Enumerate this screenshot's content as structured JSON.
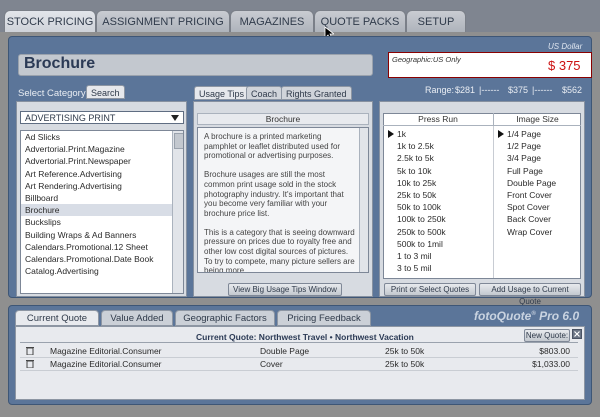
{
  "top_tabs": [
    "STOCK PRICING",
    "ASSIGNMENT PRICING",
    "MAGAZINES",
    "QUOTE PACKS",
    "SETUP"
  ],
  "header": {
    "title": "Brochure",
    "currency": "US Dollar",
    "geo_label": "Geographic:US Only",
    "price": "$ 375"
  },
  "range": {
    "label": "Range:",
    "low": "$281",
    "mid": "$375",
    "high": "$562",
    "sep": "|------"
  },
  "category": {
    "label": "Select Category",
    "search_tab": "Search",
    "dropdown_value": "ADVERTISING PRINT",
    "items": [
      "Ad Slicks",
      "Advertorial.Print.Magazine",
      "Advertorial.Print.Newspaper",
      "Art Reference.Advertising",
      "Art Rendering.Advertising",
      "Billboard",
      "Brochure",
      "Buckslips",
      "Building Wraps & Ad Banners",
      "Calendars.Promotional.12 Sheet",
      "Calendars.Promotional.Date Book",
      "Catalog.Advertising"
    ],
    "selected": "Brochure"
  },
  "middle": {
    "tabs": [
      "Usage Tips",
      "Coach",
      "Rights Granted"
    ],
    "heading": "Brochure",
    "paragraphs": [
      "A brochure is a printed marketing pamphlet or leaflet distributed used for promotional or advertising purposes.",
      "Brochure usages are still the most common print usage sold in the stock photography industry. It's important that you become very familiar with your brochure price list.",
      "This is a category that is seeing downward pressure on prices due to royalty free and other low cost digital sources of pictures. To try to compete, many picture sellers are being more"
    ],
    "button": "View Big Usage Tips Window"
  },
  "press_run": {
    "header": "Press Run",
    "items": [
      "1k",
      "1k to 2.5k",
      "2.5k to 5k",
      "5k to 10k",
      "10k to 25k",
      "25k to 50k",
      "50k to 100k",
      "100k to 250k",
      "250k to 500k",
      "500k to 1mil",
      "1 to 3 mil",
      "3 to 5 mil"
    ],
    "selected": "1k"
  },
  "image_size": {
    "header": "Image Size",
    "items": [
      "1/4 Page",
      "1/2 Page",
      "3/4 Page",
      "Full Page",
      "Double Page",
      "Front Cover",
      "Spot Cover",
      "Back Cover",
      "Wrap Cover"
    ],
    "selected": "1/4 Page"
  },
  "buttons": {
    "print": "Print or Select Quotes",
    "add": "Add Usage to Current Quote",
    "new_quote": "New Quote:"
  },
  "bottom": {
    "tabs": [
      "Current Quote",
      "Value Added",
      "Geographic Factors",
      "Pricing Feedback"
    ],
    "brand": "fotoQuote",
    "brand_version": "Pro 6.0",
    "current_quote": "Current Quote: Northwest Travel  • Northwest Vacation",
    "rows": [
      {
        "name": "Magazine Editorial.Consumer",
        "size": "Double Page",
        "run": "25k to 50k",
        "price": "$803.00"
      },
      {
        "name": "Magazine Editorial.Consumer",
        "size": "Cover",
        "run": "25k to 50k",
        "price": "$1,033.00"
      }
    ]
  },
  "icons": [
    "dropdown-arrow-icon",
    "trash-icon",
    "close-icon",
    "cursor-icon",
    "arrow-right-icon"
  ],
  "colors": {
    "panel": "#5b7599",
    "price": "#cc1111"
  }
}
